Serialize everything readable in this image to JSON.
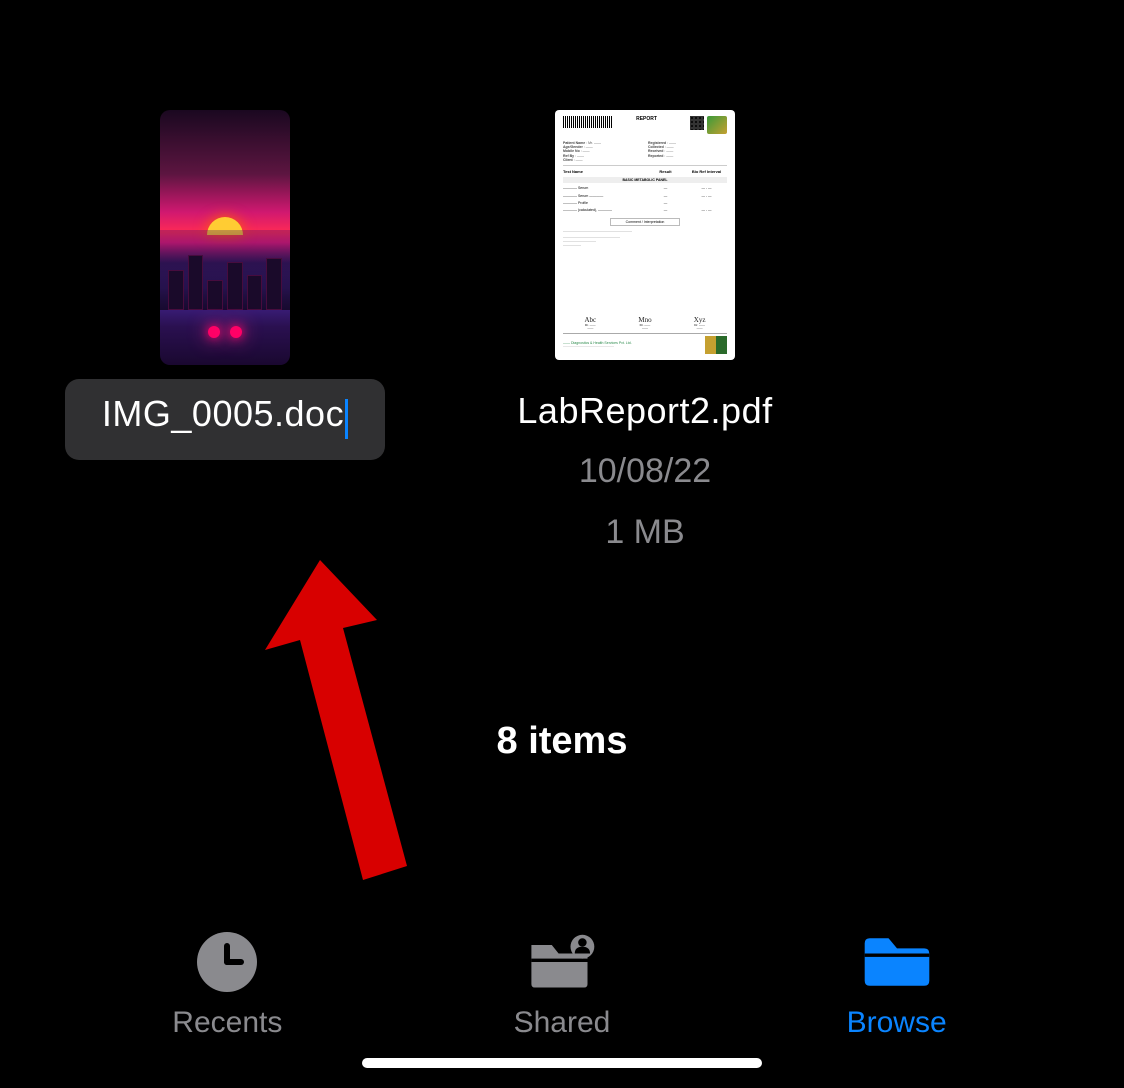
{
  "files": [
    {
      "name": "IMG_0005.doc",
      "editing": true
    },
    {
      "name": "LabReport2.pdf",
      "date": "10/08/22",
      "size": "1 MB"
    }
  ],
  "summary": "8 items",
  "tabs": {
    "recents": "Recents",
    "shared": "Shared",
    "browse": "Browse"
  },
  "colors": {
    "accent": "#0a84ff",
    "annotation": "#d80000",
    "inactive": "#8a8a8e"
  }
}
